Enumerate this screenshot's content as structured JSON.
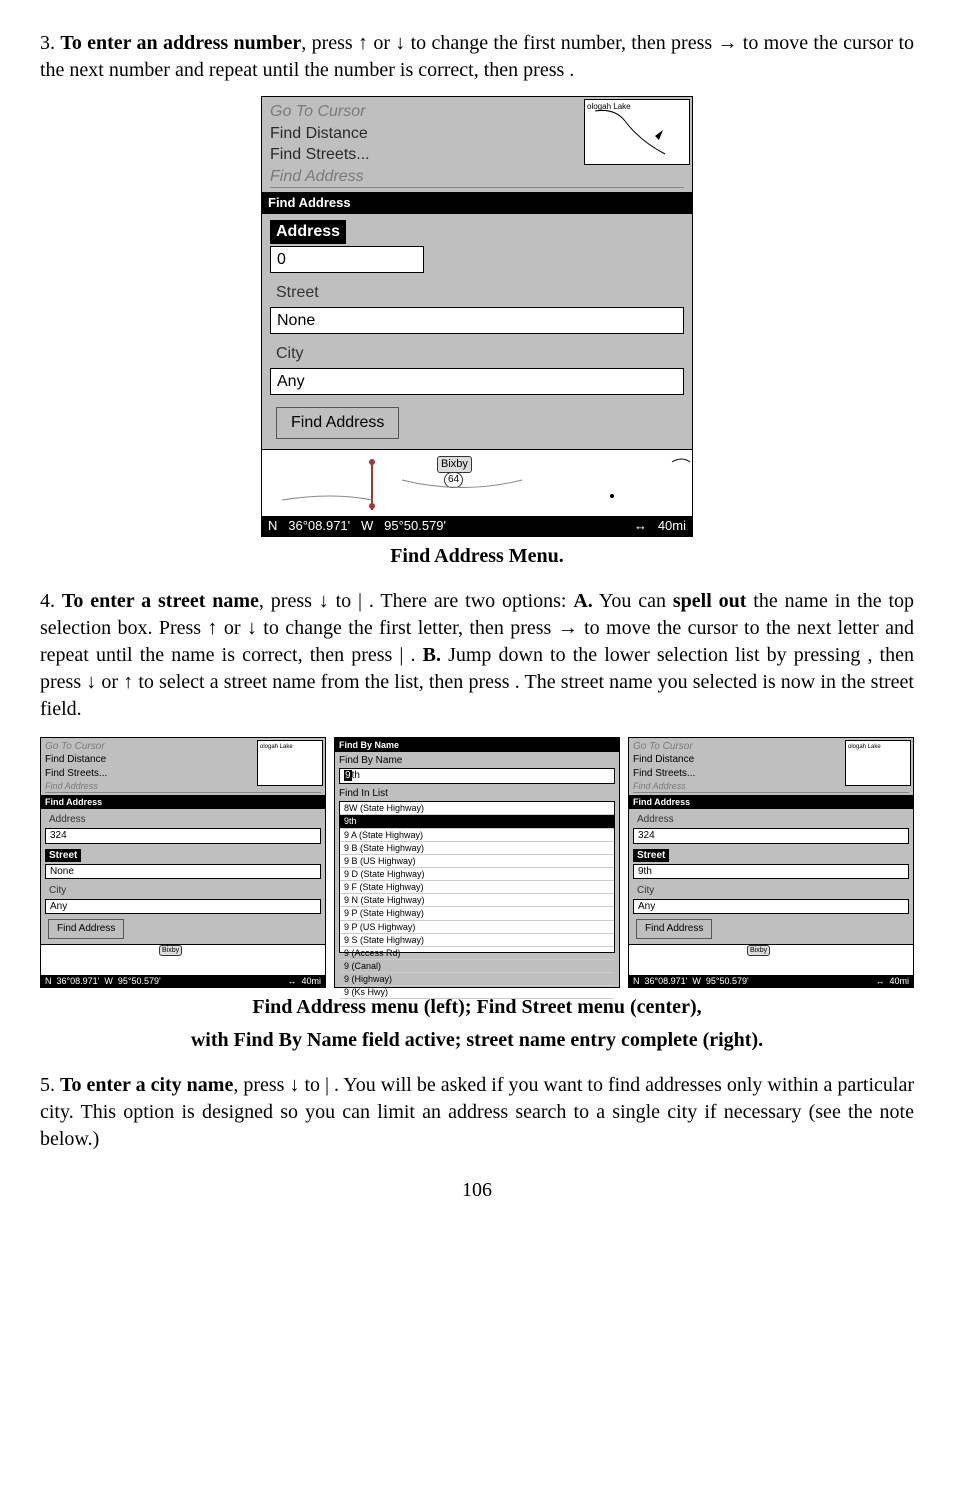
{
  "step3": {
    "prefix": "3. ",
    "lead_bold": "To enter an address number",
    "tail": ", press ↑ or ↓ to change the first number, then press → to move the cursor to the next number and repeat until the number is correct, then press      ."
  },
  "fig1": {
    "menu": {
      "go_to_cursor": "Go To Cursor",
      "find_distance": "Find Distance",
      "find_streets": "Find Streets...",
      "find_address": "Find Address"
    },
    "mini_lake": "ologah Lake",
    "title": "Find Address",
    "labels": {
      "address": "Address",
      "street": "Street",
      "city": "City"
    },
    "values": {
      "address": "0",
      "street": "None",
      "city": "Any"
    },
    "button": "Find Address",
    "bixby": "Bixby",
    "route": "64",
    "status": {
      "n": "N",
      "lat": "36°08.971'",
      "w": "W",
      "lon": "95°50.579'",
      "scale_arrow": "↔",
      "scale": "40mi"
    },
    "caption": "Find Address Menu."
  },
  "step4": {
    "prefix": "4. ",
    "lead_bold": "To enter a street name",
    "t1": ", press ↓ to             |       . There are two options: ",
    "a_bold": "A.",
    "a_text1": " You can ",
    "spell_bold": "spell out",
    "a_text2": " the name in the top selection box. Press ↑ or ↓ to change the first letter, then press → to move the cursor to the next letter and repeat until the name is correct, then press        |      . ",
    "b_bold": "B.",
    "b_text": " Jump down to the lower selection list by pressing        , then press ↓ or ↑ to select a street name from the list, then press        . The street name you selected is now in the street field."
  },
  "triple": {
    "left": {
      "title": "Find Address",
      "labels": {
        "address": "Address",
        "street": "Street",
        "city": "City"
      },
      "values": {
        "address": "324",
        "street": "None",
        "city": "Any"
      },
      "button": "Find Address"
    },
    "center": {
      "title": "Find By Name",
      "find_by_name": "Find By Name",
      "input": "9th",
      "find_in_list": "Find In List",
      "list": [
        "8W (State Highway)",
        "9th",
        "9    A (State Highway)",
        "9    B (State Highway)",
        "9    B (US Highway)",
        "9    D (State Highway)",
        "9    F (State Highway)",
        "9    N (State Highway)",
        "9    P (State Highway)",
        "9    P (US Highway)",
        "9    S (State Highway)",
        "9 (Access Rd)",
        "9 (Canal)",
        "9 (Highway)",
        "9 (Ks Hwy)"
      ],
      "sel_index": 1
    },
    "right": {
      "title": "Find Address",
      "labels": {
        "address": "Address",
        "street": "Street",
        "city": "City"
      },
      "values": {
        "address": "324",
        "street": "9th",
        "city": "Any"
      },
      "button": "Find Address"
    },
    "common": {
      "menu": {
        "go_to_cursor": "Go To Cursor",
        "find_distance": "Find Distance",
        "find_streets": "Find Streets...",
        "find_address": "Find Address"
      },
      "mini_lake": "ologah Lake",
      "bixby": "Bixby",
      "route": "64",
      "status": {
        "n": "N",
        "lat": "36°08.971'",
        "w": "W",
        "lon": "95°50.579'",
        "scale_arrow": "↔",
        "scale": "40mi"
      }
    },
    "caption1": "Find Address menu (left); Find Street menu (center),",
    "caption2": "with Find By Name field active; street name entry complete (right)."
  },
  "step5": {
    "prefix": "5. ",
    "lead_bold": "To enter a city name",
    "tail": ", press ↓ to         |       . You will be asked if you want to find addresses only within a particular city. This option is designed so you can limit an address search to a single city if necessary (see the note below.)"
  },
  "page_number": "106"
}
